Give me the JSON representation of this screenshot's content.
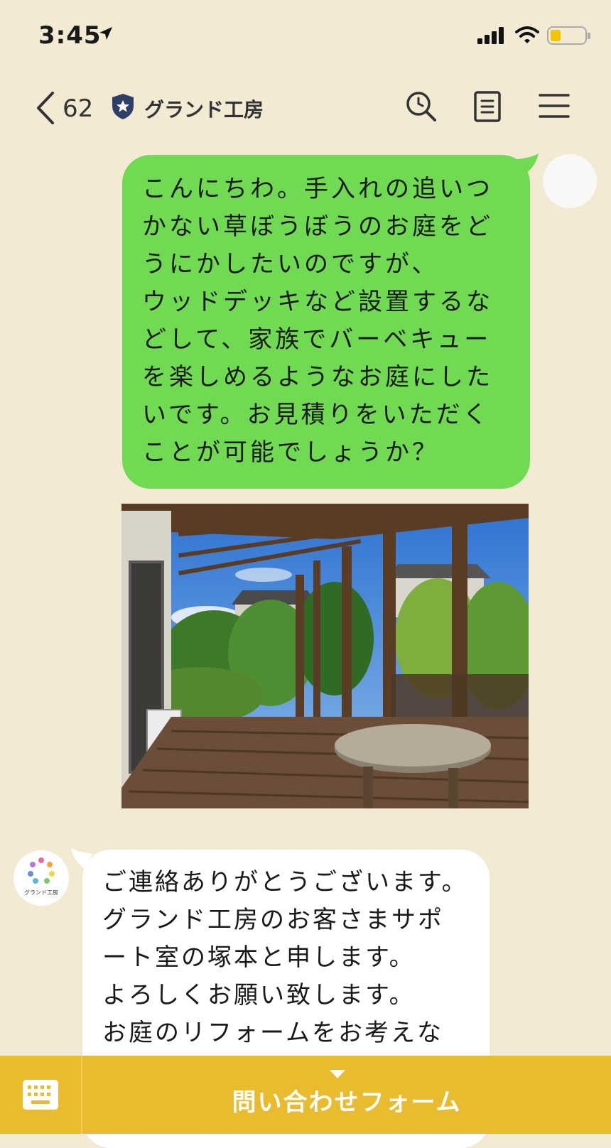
{
  "status_bar": {
    "time": "3:45"
  },
  "header": {
    "back_count": "62",
    "title": "グランド工房"
  },
  "messages": [
    {
      "sender": "me",
      "text": "こんにちわ。手入れの追いつ\nかない草ぼうぼうのお庭をど\nうにかしたいのですが、\nウッドデッキなど設置するな\nどして、家族でバーベキュー\nを楽しめるようなお庭にした\nいです。お見積りをいただく\nことが可能でしょうか？"
    },
    {
      "sender": "me",
      "type": "photo"
    },
    {
      "sender": "shop",
      "avatar_text": "グランド工房",
      "text": "ご連絡ありがとうございます。\nグランド工房のお客さまサポ\nート室の塚本と申します。\nよろしくお願い致します。\nお庭のリフォームをお考えな"
    }
  ],
  "bottom_bar": {
    "form_label": "問い合わせフォーム"
  },
  "colors": {
    "background": "#f2ead3",
    "my_bubble": "#6fda52",
    "bottom_bar": "#e9bc2f"
  }
}
